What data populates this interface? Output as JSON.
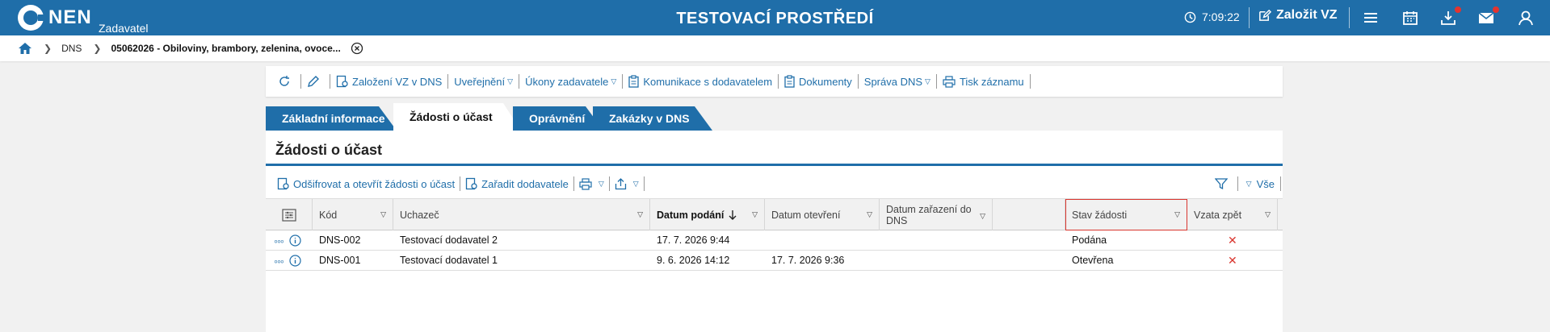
{
  "header": {
    "logo_text": "NEN",
    "logo_sub": "Zadavatel",
    "env_title": "TESTOVACÍ PROSTŘEDÍ",
    "clock": "7:09:22",
    "create_label": "Založit VZ",
    "icons": [
      "clock-icon",
      "edit-icon",
      "menu-icon",
      "calendar-icon",
      "download-icon",
      "mail-icon",
      "user-icon"
    ]
  },
  "breadcrumb": {
    "items": [
      "DNS",
      "05062026 - Obiloviny, brambory, zelenina, ovoce..."
    ]
  },
  "toolbar": {
    "items": [
      {
        "label": "Založení VZ v DNS"
      },
      {
        "label": "Uveřejnění"
      },
      {
        "label": "Úkony zadavatele"
      },
      {
        "label": "Komunikace s dodavatelem"
      },
      {
        "label": "Dokumenty"
      },
      {
        "label": "Správa DNS"
      },
      {
        "label": "Tisk záznamu"
      }
    ]
  },
  "tabs": [
    {
      "label": "Základní informace"
    },
    {
      "label": "Žádosti o účast"
    },
    {
      "label": "Oprávnění"
    },
    {
      "label": "Zakázky v DNS"
    }
  ],
  "section": {
    "title": "Žádosti o účast",
    "actions": [
      "Odšifrovat a otevřít žádosti o účast",
      "Zařadit dodavatele"
    ],
    "filter_all": "Vše"
  },
  "table": {
    "columns": [
      "Kód",
      "Uchazeč",
      "Datum podání",
      "Datum otevření",
      "Datum zařazení do DNS",
      "Stav žádosti",
      "Vzata zpět"
    ],
    "rows": [
      {
        "kod": "DNS-002",
        "uchazec": "Testovací dodavatel 2",
        "datum_podani": "17. 7. 2026 9:44",
        "datum_otevreni": "",
        "datum_zarazeni": "",
        "stav": "Podána",
        "vzata_zpet": "✕"
      },
      {
        "kod": "DNS-001",
        "uchazec": "Testovací dodavatel 1",
        "datum_podani": "9. 6. 2026 14:12",
        "datum_otevreni": "17. 7. 2026 9:36",
        "datum_zarazeni": "",
        "stav": "Otevřena",
        "vzata_zpet": "✕"
      }
    ]
  },
  "colors": {
    "primary": "#1f6ea9",
    "highlight": "#d9362f"
  }
}
